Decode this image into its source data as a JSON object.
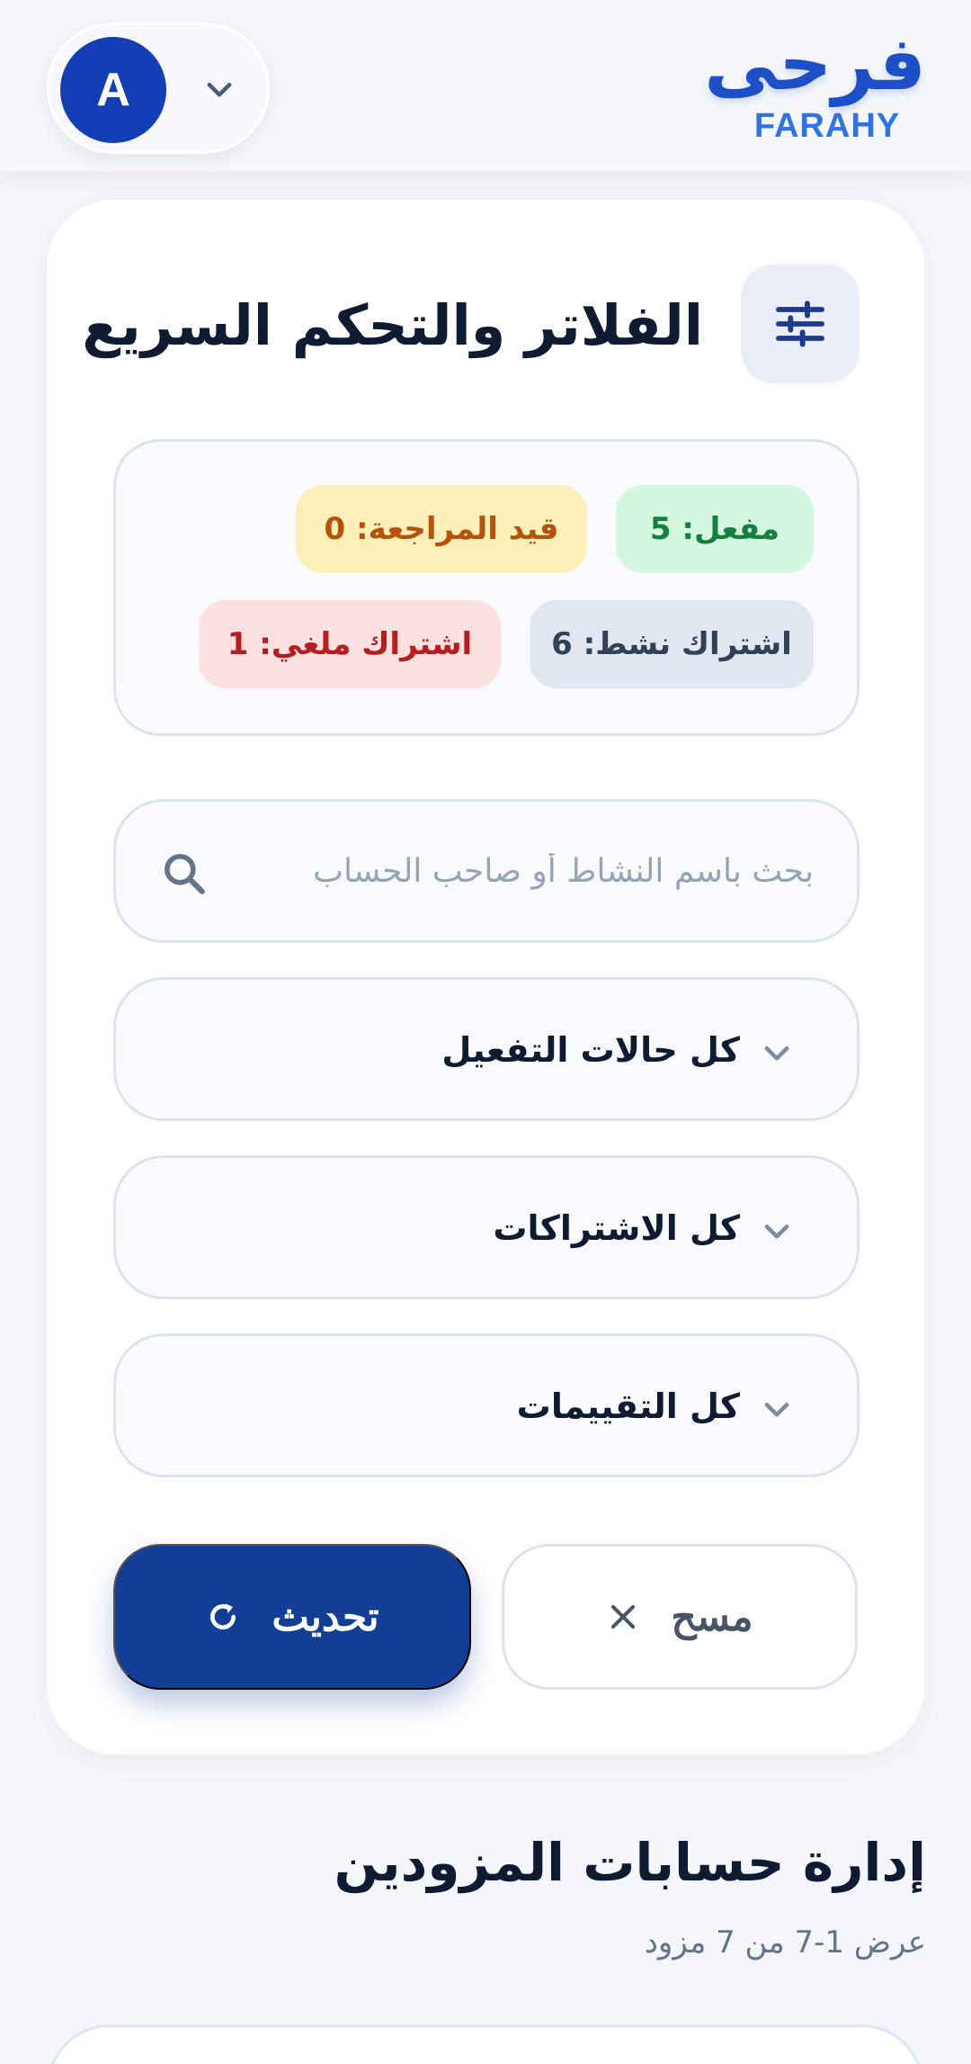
{
  "header": {
    "brand_ar": "فرحى",
    "brand_en": "FARAHY",
    "avatar_initial": "A"
  },
  "filters": {
    "title": "الفلاتر والتحكم السريع",
    "stats": {
      "active": "مفعل: 5",
      "under_review": "قيد المراجعة: 0",
      "active_subscription": "اشتراك نشط: 6",
      "cancelled_subscription": "اشتراك ملغي: 1"
    },
    "search": {
      "value": "",
      "placeholder": "بحث باسم النشاط أو صاحب الحساب"
    },
    "selects": {
      "activation_status": "كل حالات التفعيل",
      "subscriptions": "كل الاشتراكات",
      "ratings": "كل التقييمات"
    },
    "buttons": {
      "clear": "مسح",
      "refresh": "تحديث"
    }
  },
  "section": {
    "title": "إدارة حسابات المزودين",
    "subtitle": "عرض 1-7 من 7 مزود"
  },
  "icons": {
    "avatar_menu": "chevron-down-icon",
    "filters": "sliders-icon",
    "search": "search-icon",
    "select": "chevron-down-icon",
    "clear": "close-icon",
    "refresh": "refresh-icon"
  },
  "colors": {
    "brand": "#1d4fc9",
    "primary_button": "#123e96",
    "active_badge_bg": "#d3f7df",
    "review_badge_bg": "#fdefb8",
    "subscribed_badge_bg": "#e1e7f1",
    "cancelled_badge_bg": "#fde1e1"
  }
}
